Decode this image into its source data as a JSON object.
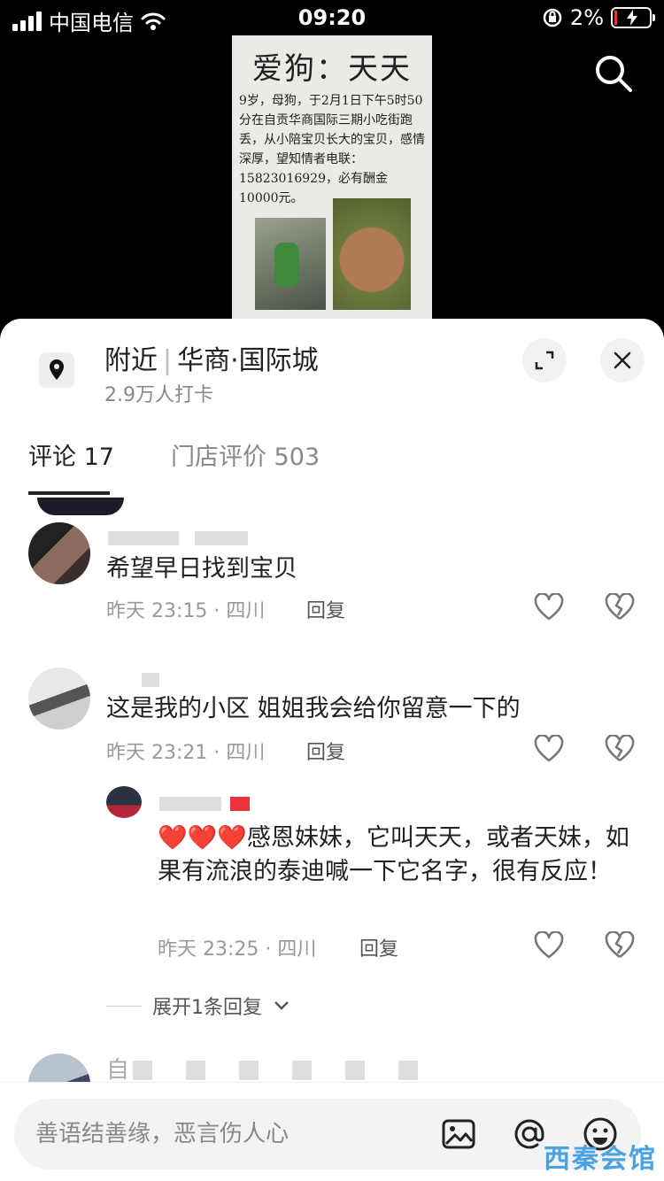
{
  "status_bar": {
    "carrier": "中国电信",
    "time": "09:20",
    "battery": "2%"
  },
  "poster": {
    "title": "爱狗：天天",
    "body": "9岁，母狗，于2月1日下午5时50分在自贡华商国际三期小吃街跑丢，从小陪宝贝长大的宝贝，感情深厚，望知情者电联：15823016929，必有酬金10000元。"
  },
  "location": {
    "prefix": "附近",
    "name": "华商·国际城",
    "checkins": "2.9万人打卡"
  },
  "tabs": [
    {
      "label": "评论 17"
    },
    {
      "label": "门店评价 503"
    }
  ],
  "comments": [
    {
      "text": "希望早日找到宝贝",
      "time": "昨天 23:15 · 四川",
      "reply": "回复"
    },
    {
      "text": "这是我的小区 姐姐我会给你留意一下的",
      "time": "昨天 23:21 · 四川",
      "reply": "回复"
    }
  ],
  "sub_reply": {
    "hearts": "❤️❤️❤️",
    "text": "感恩妹妹，它叫天天，或者天妹，如果有流浪的泰迪喊一下它名字，很有反应！",
    "time": "昨天 23:25 · 四川",
    "reply": "回复"
  },
  "expand_label": "展开1条回复",
  "partial_comment_prefix": "自",
  "input": {
    "placeholder": "善语结善缘，恶言伤人心"
  },
  "watermark": "西秦会馆",
  "colors": {
    "accent_blue": "#4aa3e0",
    "heart_red": "#e8343f"
  }
}
